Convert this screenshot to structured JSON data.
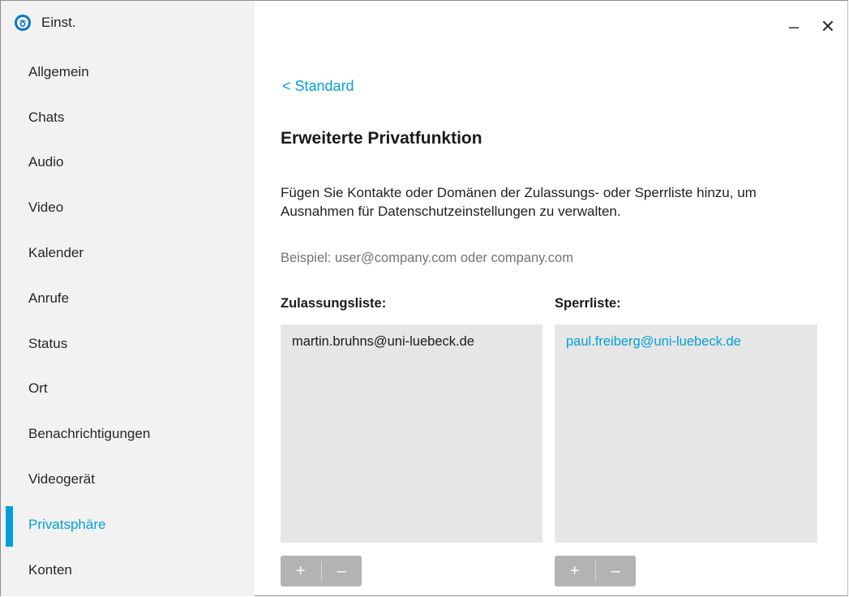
{
  "app": {
    "title": "Einst.",
    "logo_icon": "webex-logo-icon",
    "accent": "#049fd9"
  },
  "window_controls": {
    "minimize": "–",
    "close": "✕"
  },
  "sidebar": {
    "items": [
      {
        "label": "Allgemein",
        "active": false
      },
      {
        "label": "Chats",
        "active": false
      },
      {
        "label": "Audio",
        "active": false
      },
      {
        "label": "Video",
        "active": false
      },
      {
        "label": "Kalender",
        "active": false
      },
      {
        "label": "Anrufe",
        "active": false
      },
      {
        "label": "Status",
        "active": false
      },
      {
        "label": "Ort",
        "active": false
      },
      {
        "label": "Benachrichtigungen",
        "active": false
      },
      {
        "label": "Videogerät",
        "active": false
      },
      {
        "label": "Privatsphäre",
        "active": true
      },
      {
        "label": "Konten",
        "active": false
      }
    ]
  },
  "main": {
    "back_link": "< Standard",
    "heading": "Erweiterte Privatfunktion",
    "description": "Fügen Sie Kontakte oder Domänen der Zulassungs- oder Sperrliste hinzu, um Ausnahmen für Datenschutzeinstellungen zu verwalten.",
    "example": "Beispiel: user@company.com oder company.com",
    "allow_list": {
      "label": "Zulassungsliste:",
      "entries": [
        "martin.bruhns@uni-luebeck.de"
      ],
      "add": "+",
      "remove": "–"
    },
    "block_list": {
      "label": "Sperrliste:",
      "entries": [
        "paul.freiberg@uni-luebeck.de"
      ],
      "add": "+",
      "remove": "–"
    }
  }
}
